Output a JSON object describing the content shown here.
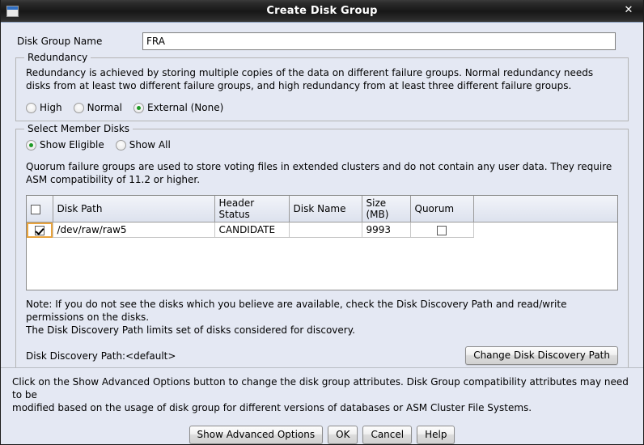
{
  "window": {
    "title": "Create Disk Group",
    "icon": "window-icon",
    "close_label": "✕"
  },
  "form": {
    "disk_group_name_label": "Disk Group Name",
    "disk_group_name_value": "FRA"
  },
  "redundancy": {
    "legend": "Redundancy",
    "description": "Redundancy is achieved by storing multiple copies of the data on different failure groups. Normal redundancy needs disks from at least two different failure groups, and high redundancy from at least three different failure groups.",
    "options": [
      {
        "label": "High",
        "selected": false
      },
      {
        "label": "Normal",
        "selected": false
      },
      {
        "label": "External (None)",
        "selected": true
      }
    ]
  },
  "member_disks": {
    "legend": "Select Member Disks",
    "filter_options": [
      {
        "label": "Show Eligible",
        "selected": true
      },
      {
        "label": "Show All",
        "selected": false
      }
    ],
    "quorum_description": "Quorum failure groups are used to store voting files in extended clusters and do not contain any user data. They require ASM compatibility of 11.2 or higher.",
    "table": {
      "columns": [
        "",
        "Disk Path",
        "Header Status",
        "Disk Name",
        "Size (MB)",
        "Quorum"
      ],
      "rows": [
        {
          "selected": true,
          "disk_path": "/dev/raw/raw5",
          "header_status": "CANDIDATE",
          "disk_name": "",
          "size_mb": "9993",
          "quorum": false
        }
      ]
    },
    "note_line1": "Note: If you do not see the disks which you believe are available, check the Disk Discovery Path and read/write permissions on the disks.",
    "note_line2": "The Disk Discovery Path limits set of disks considered for discovery.",
    "discovery_path_text": "Disk Discovery Path:<default>",
    "change_discovery_button": "Change Disk Discovery Path"
  },
  "bottom": {
    "advanced_note_line1": "Click on the Show Advanced Options button to change the disk group attributes. Disk Group compatibility attributes may need to be",
    "advanced_note_line2": "modified based on the usage of disk group for different versions of databases or ASM Cluster File Systems.",
    "buttons": [
      {
        "label": "Show Advanced Options",
        "name": "show-advanced-options-button"
      },
      {
        "label": "OK",
        "name": "ok-button"
      },
      {
        "label": "Cancel",
        "name": "cancel-button"
      },
      {
        "label": "Help",
        "name": "help-button"
      }
    ]
  },
  "colors": {
    "background": "#e4e8f3",
    "titlebar": "#1b1b1b",
    "radio_selected": "#1e9a26",
    "focus_ring": "#e8a33d"
  }
}
